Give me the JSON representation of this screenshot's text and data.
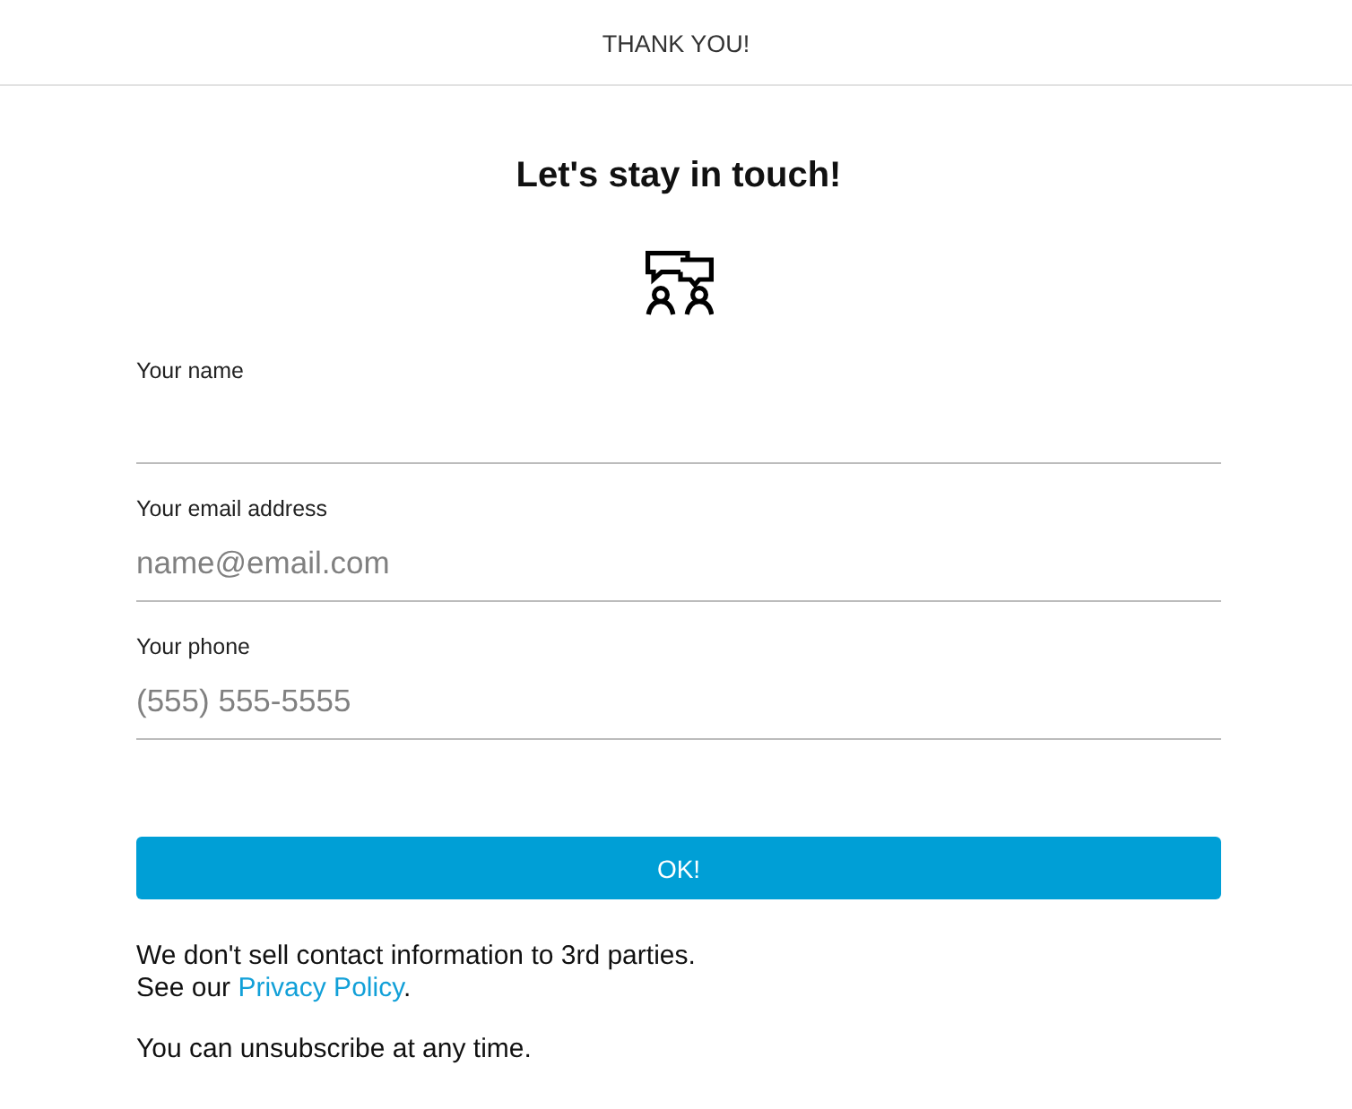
{
  "header": {
    "title": "THANK YOU!"
  },
  "form": {
    "heading": "Let's stay in touch!",
    "fields": [
      {
        "label": "Your name"
      },
      {
        "label": "Your email address",
        "placeholder": "name@email.com"
      },
      {
        "label": "Your phone",
        "placeholder": "(555) 555-5555"
      }
    ],
    "submit": "OK!"
  },
  "privacy_notice": {
    "text": "We don't sell contact information to 3rd parties.",
    "link_prefix": "See our",
    "link": "Privacy Policy",
    "link_suffix": "."
  },
  "unsubscribe_notice": "You can unsubscribe at any time."
}
